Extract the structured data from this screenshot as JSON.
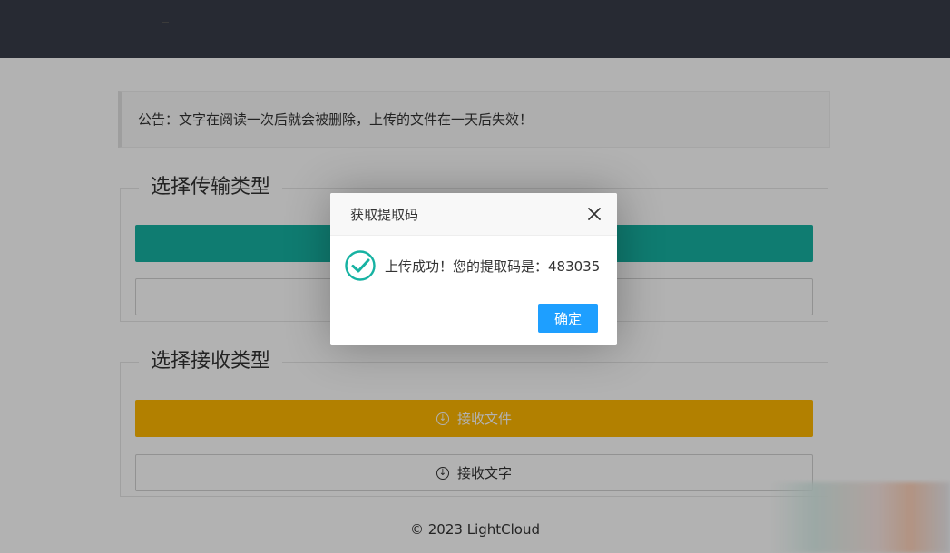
{
  "notice": {
    "text": "公告：文字在阅读一次后就会被删除，上传的文件在一天后失效！"
  },
  "send_section": {
    "title": "选择传输类型"
  },
  "receive_section": {
    "title": "选择接收类型",
    "receive_file_label": "接收文件",
    "receive_text_label": "接收文字"
  },
  "footer": {
    "text": "© 2023 LightCloud"
  },
  "dialog": {
    "title": "获取提取码",
    "message": "上传成功！您的提取码是：483035",
    "ok_label": "确定"
  },
  "colors": {
    "topbar": "#393d49",
    "teal": "#16b2a2",
    "yellow": "#ffb800",
    "primary_blue": "#1e9fff",
    "success_green": "#16b2a2"
  },
  "icons": {
    "download": "download-circle-icon",
    "close": "close-icon",
    "success": "success-check-icon"
  }
}
